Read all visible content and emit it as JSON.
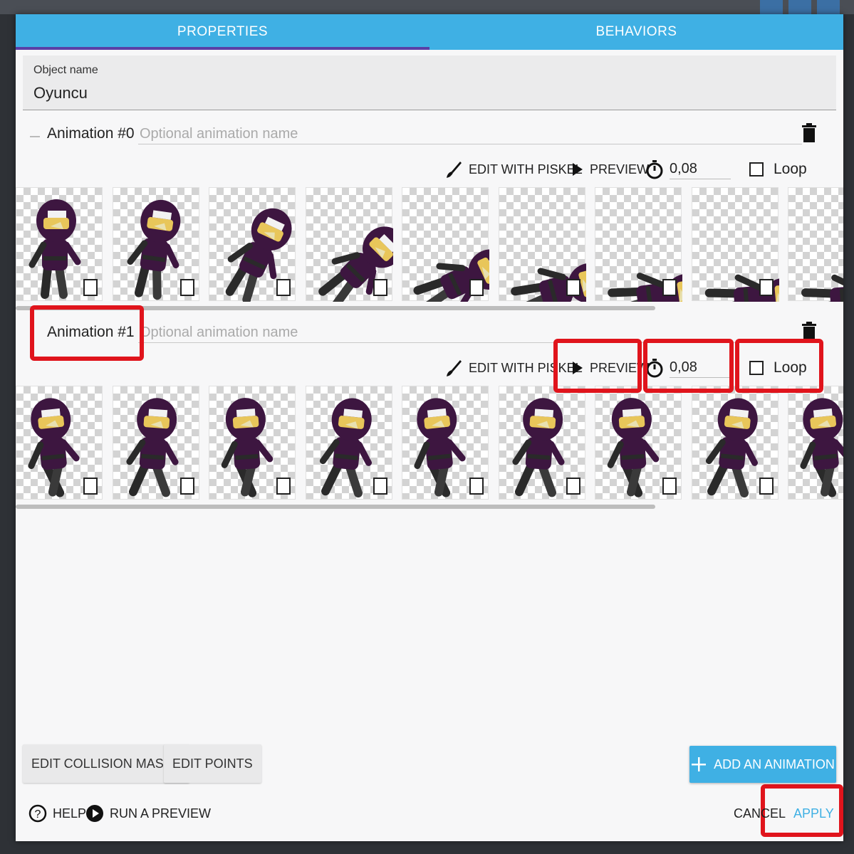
{
  "tabs": [
    {
      "label": "PROPERTIES",
      "active": true
    },
    {
      "label": "BEHAVIORS",
      "active": false
    }
  ],
  "object_name": {
    "label": "Object name",
    "value": "Oyuncu"
  },
  "animations": [
    {
      "title": "Animation #0",
      "name_placeholder": "Optional animation name",
      "edit_label": "EDIT WITH PISKEL",
      "preview_label": "PREVIEW",
      "timing": "0,08",
      "loop_label": "Loop",
      "loop_checked": false,
      "frame_count_visible": 9,
      "pose": "falling"
    },
    {
      "title": "Animation #1",
      "name_placeholder": "Optional animation name",
      "edit_label": "EDIT WITH PISKEL",
      "preview_label": "PREVIEW",
      "timing": "0,08",
      "loop_label": "Loop",
      "loop_checked": false,
      "frame_count_visible": 9,
      "pose": "running"
    }
  ],
  "bottom_buttons": {
    "collision": "EDIT COLLISION MASKS",
    "points": "EDIT POINTS",
    "add_animation": "ADD AN ANIMATION"
  },
  "footer": {
    "help": "HELP",
    "run_preview": "RUN A PREVIEW",
    "cancel": "CANCEL",
    "apply": "APPLY"
  },
  "colors": {
    "accent": "#3fb0e4",
    "tab_indicator": "#5a3fa6",
    "highlight": "#e0141c",
    "ninja_body": "#3d1640",
    "ninja_face": "#e8c65a"
  },
  "icons": [
    "trash-icon",
    "brush-icon",
    "play-icon",
    "stopwatch-icon",
    "checkbox-icon",
    "plus-icon",
    "help-icon",
    "play-circle-icon"
  ]
}
